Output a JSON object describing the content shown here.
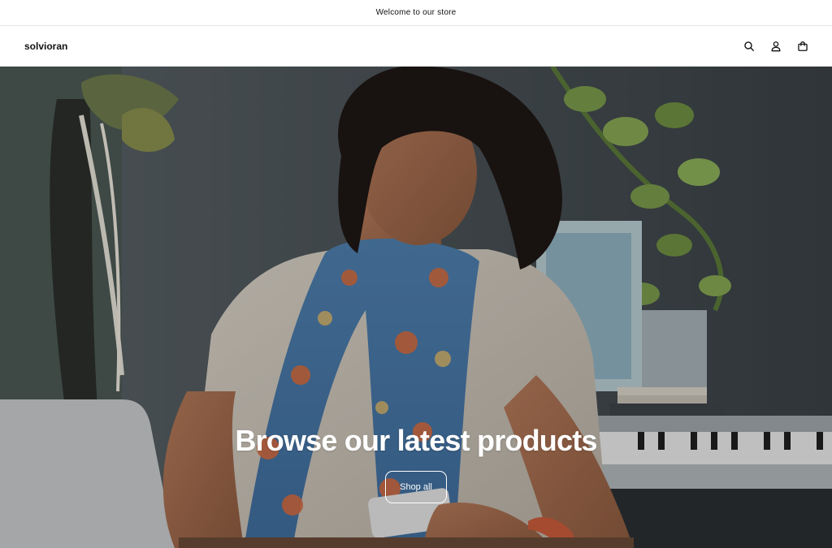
{
  "announcement": {
    "text": "Welcome to our store"
  },
  "header": {
    "logo": "solvioran",
    "icons": [
      "search-icon",
      "account-icon",
      "cart-icon"
    ]
  },
  "hero": {
    "title": "Browse our latest products",
    "button_label": "Shop all"
  },
  "colors": {
    "text": "#121212",
    "background": "#ffffff",
    "hero_text": "#ffffff"
  }
}
